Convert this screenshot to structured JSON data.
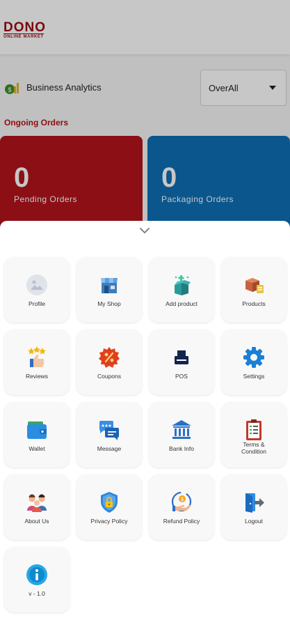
{
  "app": {
    "logo_main": "DONO",
    "logo_sub": "ONLINE MARKET"
  },
  "analytics": {
    "label": "Business Analytics",
    "filter_value": "OverAll"
  },
  "ongoing": {
    "title": "Ongoing Orders",
    "cards": [
      {
        "count": "0",
        "label": "Pending  Orders",
        "color": "#b3141b"
      },
      {
        "count": "0",
        "label": "Packaging  Orders",
        "color": "#0d6fb5"
      }
    ]
  },
  "menu": {
    "items": [
      {
        "label": "Profile",
        "icon": "profile-icon"
      },
      {
        "label": "My Shop",
        "icon": "shop-icon"
      },
      {
        "label": "Add product",
        "icon": "add-product-icon"
      },
      {
        "label": "Products",
        "icon": "products-icon"
      },
      {
        "label": "Reviews",
        "icon": "reviews-icon"
      },
      {
        "label": "Coupons",
        "icon": "coupon-icon"
      },
      {
        "label": "POS",
        "icon": "pos-icon"
      },
      {
        "label": "Settings",
        "icon": "gear-icon"
      },
      {
        "label": "Wallet",
        "icon": "wallet-icon"
      },
      {
        "label": "Message",
        "icon": "message-icon"
      },
      {
        "label": "Bank Info",
        "icon": "bank-icon"
      },
      {
        "label": "Terms &\nCondition",
        "icon": "terms-icon"
      },
      {
        "label": "About Us",
        "icon": "about-us-icon"
      },
      {
        "label": "Privacy Policy",
        "icon": "privacy-icon"
      },
      {
        "label": "Refund Policy",
        "icon": "refund-icon"
      },
      {
        "label": "Logout",
        "icon": "logout-icon"
      },
      {
        "label": "v - 1.0",
        "icon": "info-icon"
      }
    ]
  },
  "colors": {
    "brand_red": "#b3141b",
    "brand_blue": "#0d6fb5"
  }
}
